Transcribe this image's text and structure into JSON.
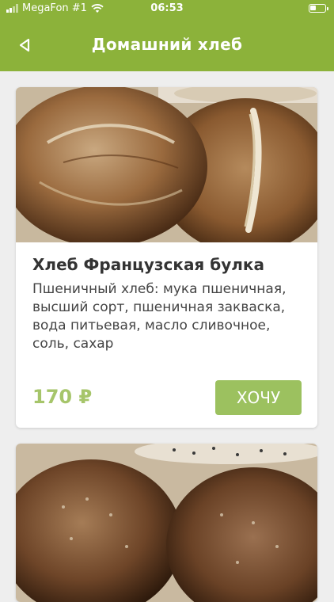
{
  "status_bar": {
    "carrier": "MegaFon #1",
    "time": "06:53"
  },
  "header": {
    "title": "Домашний хлеб",
    "back_icon": "back-arrow-icon",
    "color": "#8cb23a"
  },
  "products": [
    {
      "name": "Хлеб Французская булка",
      "description": "Пшеничный хлеб: мука пшеничная, высший сорт, пшеничная закваска, вода питьевая, масло сливочное, соль, сахар",
      "price": "170 ₽",
      "button_label": "ХОЧУ",
      "image": "bread-photo"
    },
    {
      "image": "seeded-bread-photo"
    }
  ],
  "colors": {
    "price": "#a6c56a",
    "button": "#9cc15f",
    "background": "#eeeeee"
  }
}
